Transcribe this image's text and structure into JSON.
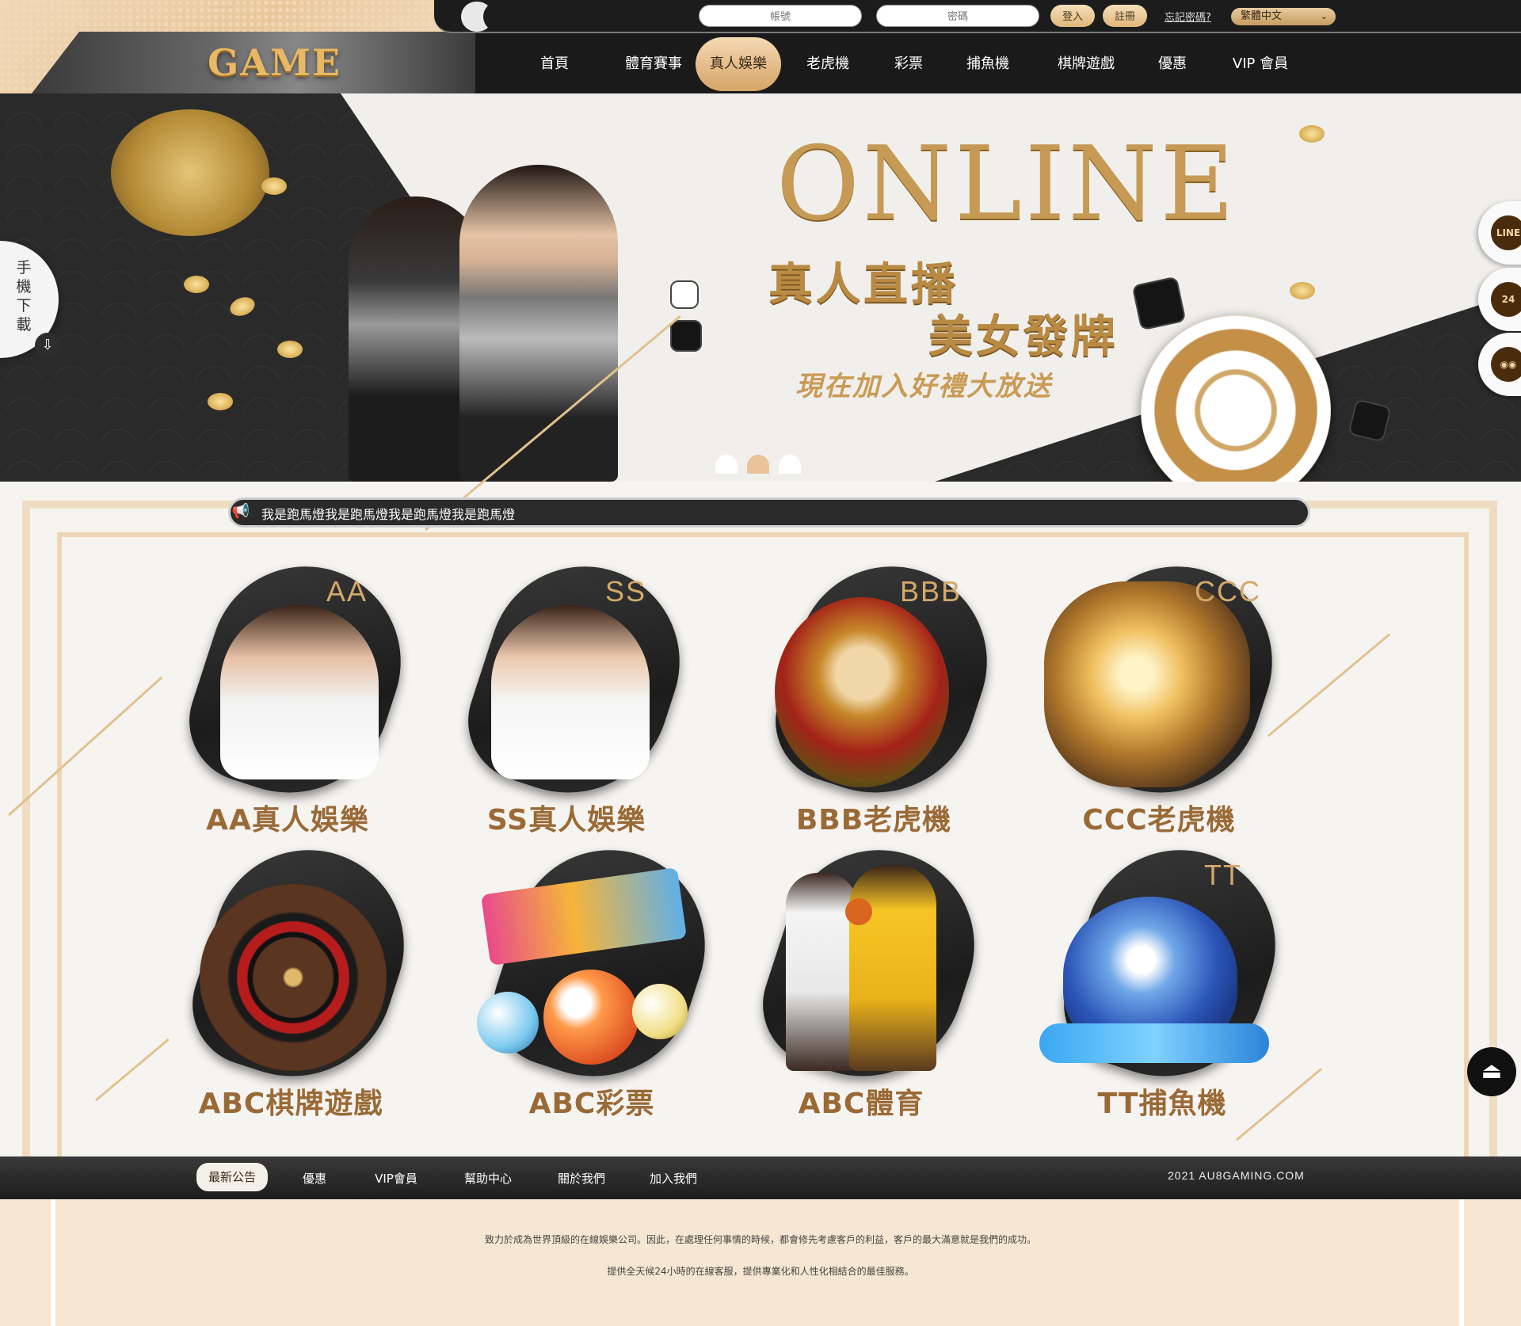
{
  "header": {
    "logo_text": "GAME",
    "account_placeholder": "帳號",
    "password_placeholder": "密碼",
    "login_label": "登入",
    "register_label": "註冊",
    "forgot_label": "忘記密碼?",
    "language_label": "繁體中文",
    "nav": [
      "首頁",
      "體育賽事",
      "真人娛樂",
      "老虎機",
      "彩票",
      "捕魚機",
      "棋牌遊戲",
      "優惠",
      "VIP 會員"
    ],
    "active_nav": "真人娛樂"
  },
  "banner": {
    "headline": "ONLINE",
    "line1": "真人直播",
    "line2": "美女發牌",
    "line3": "現在加入好禮大放送",
    "slides": 3,
    "active_slide": 2
  },
  "side": {
    "download_label": "手機下載",
    "line_label": "LINE",
    "support_label": "24",
    "wechat_label": "WeChat"
  },
  "marquee": {
    "text": "我是跑馬燈我是跑馬燈我是跑馬燈我是跑馬燈"
  },
  "games": [
    {
      "tag": "AA",
      "label": "AA真人娛樂",
      "art": "live-dealer-woman"
    },
    {
      "tag": "SS",
      "label": "SS真人娛樂",
      "art": "live-dealer-woman"
    },
    {
      "tag": "BBB",
      "label": "BBB老虎機",
      "art": "warrior"
    },
    {
      "tag": "CCC",
      "label": "CCC老虎機",
      "art": "zeus"
    },
    {
      "tag": "",
      "label": "ABC棋牌遊戲",
      "art": "roulette"
    },
    {
      "tag": "",
      "label": "ABC彩票",
      "art": "bingo-balls"
    },
    {
      "tag": "",
      "label": "ABC體育",
      "art": "basketball-players"
    },
    {
      "tag": "TT",
      "label": "TT捕魚機",
      "art": "shark"
    }
  ],
  "footer": {
    "links": [
      "最新公告",
      "優惠",
      "VIP會員",
      "幫助中心",
      "關於我們",
      "加入我們"
    ],
    "active_link": "最新公告",
    "copyright": "2021 AU8GAMING.COM",
    "line1": "致力於成為世界頂級的在線娛樂公司。因此，在處理任何事情的時候，都會修先考慮客戶的利益，客戶的最大滿意就是我們的成功。",
    "line2": "提供全天候24小時的在線客服，提供專業化和人性化相結合的最佳服務。"
  },
  "colors": {
    "gold": "#d6a467",
    "dark": "#1c1c1c",
    "label_brown": "#9a6a36"
  }
}
